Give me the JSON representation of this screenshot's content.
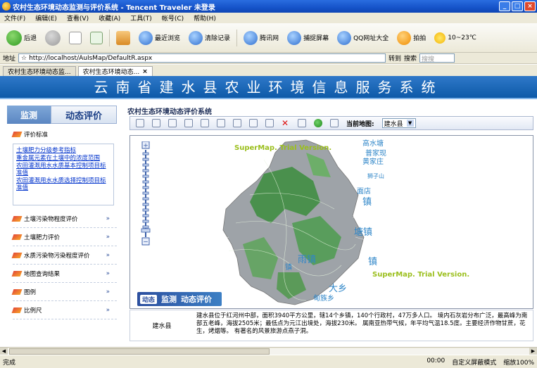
{
  "window": {
    "title": "农村生态环境动态监测与评价系统 - Tencent Traveler 未登录"
  },
  "menu": [
    "文件(F)",
    "编辑(E)",
    "查看(V)",
    "收藏(A)",
    "工具(T)",
    "帐号(C)",
    "帮助(H)"
  ],
  "toolbar": {
    "back": "后退",
    "recent": "最近浏览",
    "clear": "清除记录",
    "tencent": "腾讯网",
    "capture": "捕捉屏幕",
    "qq_sites": "QQ网址大全",
    "paipai": "拍拍",
    "weather": "10~23℃"
  },
  "address": {
    "label": "地址",
    "url": "http://localhost/AuIsMap/DefaultR.aspx",
    "go": "转到",
    "search_label": "搜索",
    "search_placeholder": "搜搜"
  },
  "tabs": [
    "农村生态环境动态监...",
    "农村生态环境动态..."
  ],
  "banner": {
    "title": "云南省建水县农业环境信息服务系统"
  },
  "left": {
    "tab_monitor": "监测",
    "tab_eval": "动态评价",
    "expanded_section": "评价标准",
    "links": [
      "土壤肥力分级参考指标",
      "重金属元素在土壤中的浓度范围",
      "农田灌溉用水水质基本控制项目标准值",
      "农田灌溉用水水质选择控制项目标准值"
    ],
    "sections": [
      "土壤污染物程度评价",
      "土壤肥力评价",
      "水质污染物污染程度评价",
      "地图查询结果",
      "图例",
      "比例尺"
    ]
  },
  "content": {
    "title": "农村生态环境动态评价系统",
    "current_map_label": "当前地图:",
    "current_map_value": "建水县",
    "watermark": "SuperMap. Trial Version.",
    "places": [
      "高水塘",
      "普家现",
      "黄家庄",
      "狮子山",
      "面店",
      "镇",
      "塘镇",
      "镇",
      "雨镇",
      "镇",
      "大乡",
      "甸族乡"
    ],
    "logo_small": "动态",
    "logo_main": "监测",
    "logo_eval": "动态评价",
    "info_name": "建水县",
    "info_desc": "建水县位于红河州中部，面积3940平方公里，辖14个乡镇，140个行政村，47万多人口。 境内石灰岩分布广泛，最高峰为南部五老峰，海拔2505米；最低点为元江出境处，海拔230米。 属南亚热带气候，年平均气温18.5度。主要经济作物甘蔗，花生，烤烟等。 有著名的风景旅游点燕子洞。"
  },
  "status": {
    "left": "完成",
    "time": "00:00",
    "mode": "自定义屏蔽模式",
    "zoom": "缩放100%"
  }
}
